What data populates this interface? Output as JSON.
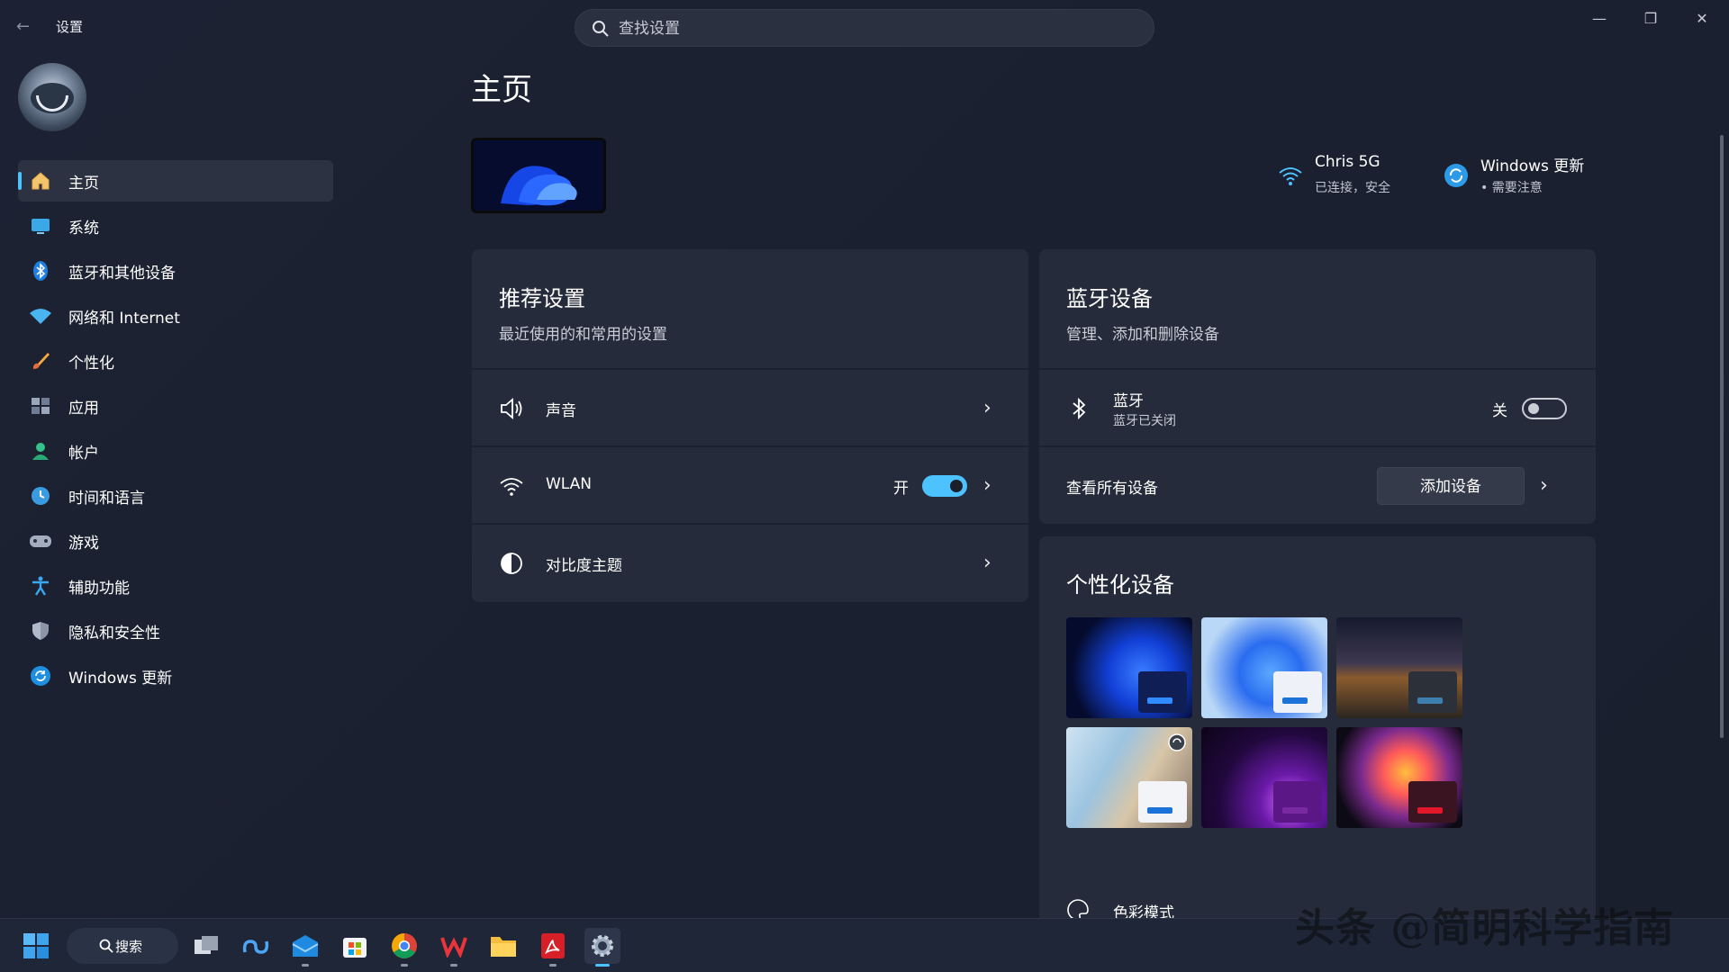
{
  "window": {
    "back_glyph": "←",
    "title": "设置",
    "minimize_glyph": "—",
    "maximize_glyph": "❐",
    "close_glyph": "✕"
  },
  "search": {
    "placeholder": "查找设置",
    "value": ""
  },
  "sidebar": {
    "items": [
      {
        "label": "主页",
        "icon": "home-icon",
        "active": true
      },
      {
        "label": "系统",
        "icon": "system-icon"
      },
      {
        "label": "蓝牙和其他设备",
        "icon": "bluetooth-icon"
      },
      {
        "label": "网络和 Internet",
        "icon": "network-icon"
      },
      {
        "label": "个性化",
        "icon": "brush-icon"
      },
      {
        "label": "应用",
        "icon": "apps-icon"
      },
      {
        "label": "帐户",
        "icon": "account-icon"
      },
      {
        "label": "时间和语言",
        "icon": "time-language-icon"
      },
      {
        "label": "游戏",
        "icon": "gaming-icon"
      },
      {
        "label": "辅助功能",
        "icon": "accessibility-icon"
      },
      {
        "label": "隐私和安全性",
        "icon": "shield-icon"
      },
      {
        "label": "Windows 更新",
        "icon": "update-icon"
      }
    ]
  },
  "main": {
    "title": "主页",
    "status": [
      {
        "title": "Chris 5G",
        "subtitle": "已连接，安全",
        "icon": "wifi-icon"
      },
      {
        "title": "Windows 更新",
        "subtitle": "• 需要注意",
        "icon": "update-icon"
      }
    ],
    "recommended": {
      "title": "推荐设置",
      "subtitle": "最近使用的和常用的设置",
      "rows": [
        {
          "label": "声音",
          "icon": "speaker-icon"
        },
        {
          "label": "WLAN",
          "icon": "wifi-icon",
          "toggle_text": "开",
          "toggle_on": true
        },
        {
          "label": "对比度主题",
          "icon": "contrast-icon"
        }
      ]
    },
    "bluetooth": {
      "title": "蓝牙设备",
      "subtitle": "管理、添加和删除设备",
      "bt_label": "蓝牙",
      "bt_sub": "蓝牙已关闭",
      "toggle_text": "关",
      "toggle_on": false,
      "view_all": "查看所有设备",
      "add_device": "添加设备"
    },
    "personalize": {
      "title": "个性化设备",
      "color_mode": "色彩模式"
    }
  },
  "taskbar": {
    "search_label": "搜索",
    "apps": [
      "start-icon",
      "task-view-icon",
      "copilot-icon",
      "mail-icon",
      "store-icon",
      "chrome-icon",
      "wps-icon",
      "file-explorer-icon",
      "acrobat-icon",
      "settings-icon"
    ]
  },
  "watermark": "头条 @简明科学指南",
  "colors": {
    "accent": "#4cc2ff",
    "background": "#1b2030",
    "card": "#252b3a"
  }
}
